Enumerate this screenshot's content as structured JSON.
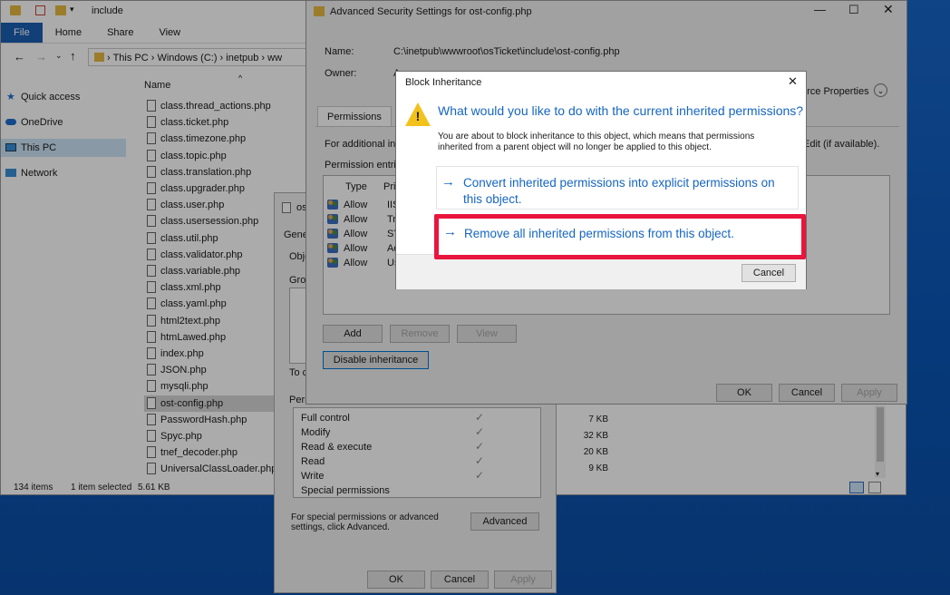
{
  "explorer": {
    "title": "include",
    "ribbon_tabs": [
      "File",
      "Home",
      "Share",
      "View"
    ],
    "breadcrumb": [
      "This PC",
      "Windows (C:)",
      "inetpub",
      "ww"
    ],
    "column_name": "Name",
    "nav": [
      "Quick access",
      "OneDrive",
      "This PC",
      "Network"
    ],
    "files": [
      "class.thread_actions.php",
      "class.ticket.php",
      "class.timezone.php",
      "class.topic.php",
      "class.translation.php",
      "class.upgrader.php",
      "class.user.php",
      "class.usersession.php",
      "class.util.php",
      "class.validator.php",
      "class.variable.php",
      "class.xml.php",
      "class.yaml.php",
      "html2text.php",
      "htmLawed.php",
      "index.php",
      "JSON.php",
      "mysqli.php",
      "ost-config.php",
      "PasswordHash.php",
      "Spyc.php",
      "tnef_decoder.php",
      "UniversalClassLoader.php"
    ],
    "sizes": [
      "7 KB",
      "32 KB",
      "20 KB",
      "9 KB"
    ],
    "status_items": "134 items",
    "status_selected": "1 item selected",
    "status_size": "5.61 KB"
  },
  "props": {
    "title": "os",
    "tab": "Gene",
    "object_label": "Obje",
    "group_label": "Grou",
    "to_label": "To c",
    "perm_label": "Perm",
    "permissions": [
      "Full control",
      "Modify",
      "Read & execute",
      "Read",
      "Write",
      "Special permissions"
    ],
    "advanced_text": "For special permissions or advanced settings, click Advanced.",
    "advanced_button": "Advanced",
    "ok": "OK",
    "cancel": "Cancel",
    "apply": "Apply"
  },
  "adv": {
    "title": "Advanced Security Settings for ost-config.php",
    "name_label": "Name:",
    "name_value": "C:\\inetpub\\wwwroot\\osTicket\\include\\ost-config.php",
    "owner_label": "Owner:",
    "owner_value": "A",
    "resource_props": "urce Properties",
    "tab_permissions": "Permissions",
    "for_additional": "For additional inf",
    "edit_text": "Edit (if available).",
    "entries_label": "Permission entrie",
    "col_type": "Type",
    "col_principal": "Pri",
    "entries": [
      {
        "type": "Allow",
        "principal": "IIS_"
      },
      {
        "type": "Allow",
        "principal": "Tru"
      },
      {
        "type": "Allow",
        "principal": "SYS"
      },
      {
        "type": "Allow",
        "principal": "Ad"
      },
      {
        "type": "Allow",
        "principal": "Use"
      }
    ],
    "add": "Add",
    "remove": "Remove",
    "view": "View",
    "disable_inheritance": "Disable inheritance",
    "ok": "OK",
    "cancel": "Cancel",
    "apply": "Apply"
  },
  "block": {
    "title": "Block Inheritance",
    "heading": "What would you like to do with the current inherited permissions?",
    "description": "You are about to block inheritance to this object, which means that permissions inherited from a parent object will no longer be applied to this object.",
    "option_convert": "Convert inherited permissions into explicit permissions on this object.",
    "option_remove": "Remove all inherited permissions from this object.",
    "cancel": "Cancel"
  },
  "colors": {
    "accent": "#1565c0",
    "highlight": "#e8153d",
    "warning": "#f2c21b"
  }
}
